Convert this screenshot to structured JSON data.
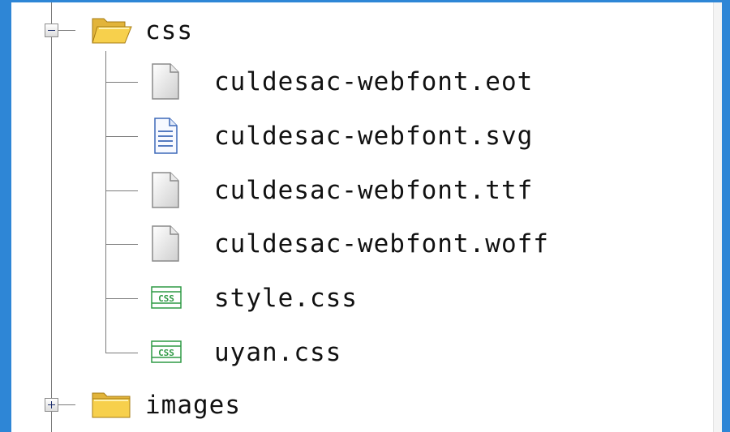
{
  "tree": {
    "folder_css": {
      "label": "css",
      "state": "expanded",
      "icon": "open-folder-icon",
      "expander_icon": "collapse-minus-icon"
    },
    "files": [
      {
        "label": "culdesac-webfont.eot",
        "icon": "blank-file-icon"
      },
      {
        "label": "culdesac-webfont.svg",
        "icon": "text-document-icon"
      },
      {
        "label": "culdesac-webfont.ttf",
        "icon": "blank-file-icon"
      },
      {
        "label": "culdesac-webfont.woff",
        "icon": "blank-file-icon"
      },
      {
        "label": "style.css",
        "icon": "css-file-icon",
        "icon_text": "CSS"
      },
      {
        "label": "uyan.css",
        "icon": "css-file-icon",
        "icon_text": "CSS"
      }
    ],
    "folder_images": {
      "label": "images",
      "state": "collapsed",
      "icon": "closed-folder-icon",
      "expander_icon": "expand-plus-icon"
    }
  },
  "colors": {
    "window_frame": "#2e86d6",
    "folder": "#f7d04c",
    "css_badge": "#2f9a45",
    "text_doc": "#3d68b8",
    "tree_line": "#7b7b7b"
  }
}
